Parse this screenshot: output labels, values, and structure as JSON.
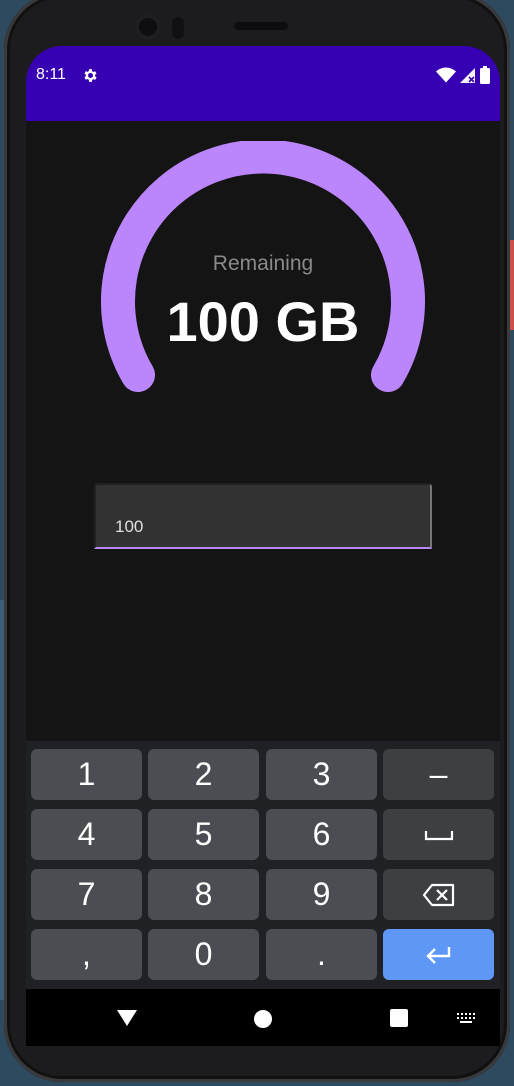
{
  "status_bar": {
    "time": "8:11",
    "icons": [
      "gear-icon",
      "wifi-icon",
      "signal-icon",
      "battery-icon"
    ],
    "background_color": "#3700b3"
  },
  "gauge": {
    "label": "Remaining",
    "value_text": "100 GB",
    "fill_fraction": 1.0,
    "arc_color": "#bb86fc"
  },
  "input": {
    "value": "100",
    "underline_color": "#bb86fc"
  },
  "keyboard": {
    "rows": [
      [
        "1",
        "2",
        "3",
        "–"
      ],
      [
        "4",
        "5",
        "6",
        "space-icon"
      ],
      [
        "7",
        "8",
        "9",
        "backspace-icon"
      ],
      [
        ",",
        "0",
        ".",
        "enter-icon"
      ]
    ],
    "enter_color": "#5e97f6"
  },
  "nav_bar": {
    "buttons": [
      "back-icon",
      "home-icon",
      "recents-icon",
      "keyboard-switch-icon"
    ]
  }
}
